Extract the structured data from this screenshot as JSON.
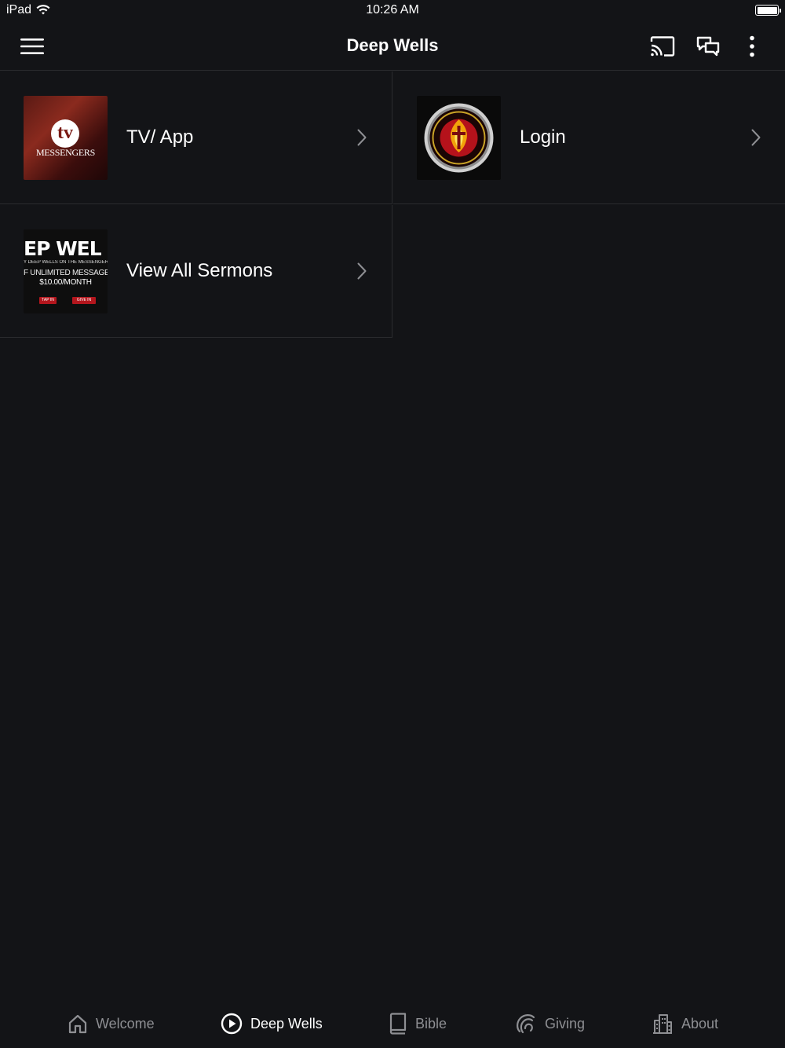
{
  "status_bar": {
    "device": "iPad",
    "time": "10:26 AM"
  },
  "nav": {
    "title": "Deep Wells"
  },
  "items": [
    {
      "label": "TV/ App",
      "thumb": {
        "logo": "tv",
        "text": "MESSENGERS"
      }
    },
    {
      "label": "Login",
      "thumb": {
        "emblem": "Messengers of Fire Ministries seal"
      }
    },
    {
      "label": "View All Sermons",
      "thumb": {
        "title": "EP WEL",
        "subtitle": "Y DEEP WELLS ON THE MESSENGERS",
        "line1": "F UNLIMITED MESSAGE",
        "line2": "$10.00/MONTH",
        "button1": "TAP IN",
        "button2": "GIVE IN"
      }
    }
  ],
  "tabs": [
    {
      "label": "Welcome",
      "icon": "home-icon",
      "active": false
    },
    {
      "label": "Deep Wells",
      "icon": "play-circle-icon",
      "active": true
    },
    {
      "label": "Bible",
      "icon": "book-icon",
      "active": false
    },
    {
      "label": "Giving",
      "icon": "giving-icon",
      "active": false
    },
    {
      "label": "About",
      "icon": "building-icon",
      "active": false
    }
  ],
  "colors": {
    "background": "#131417",
    "divider": "#2a2b2e",
    "text": "#ffffff",
    "inactive_tab": "#8e8f93",
    "chevron": "#8e8f93"
  }
}
